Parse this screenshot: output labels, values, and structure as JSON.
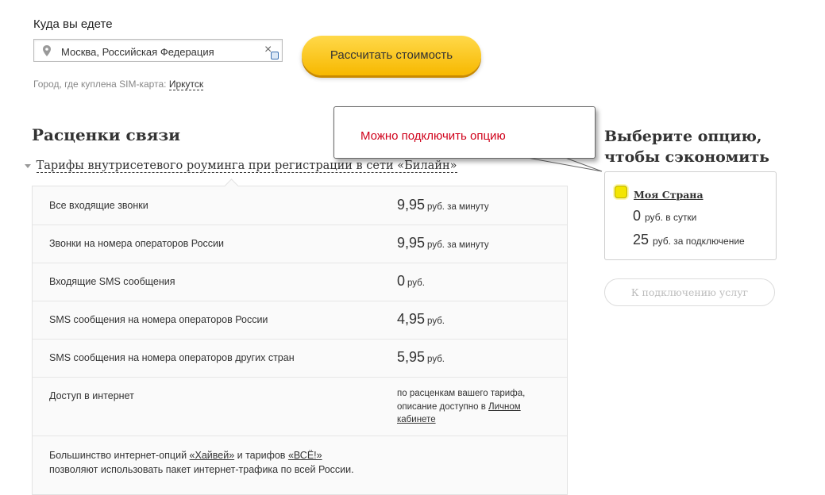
{
  "destination": {
    "label": "Куда вы едете",
    "value": "Москва, Российская Федерация",
    "calc_button": "Рассчитать стоимость"
  },
  "sim": {
    "label": "Город, где куплена SIM-карта:",
    "city": "Иркутск"
  },
  "rates": {
    "title": "Расценки связи",
    "tariffs_link": "Тарифы внутрисетевого роуминга при регистрации в сети «Билайн»",
    "rows": [
      {
        "name": "Все входящие звонки",
        "value": "9,95",
        "unit": "руб. за минуту"
      },
      {
        "name": "Звонки на номера операторов России",
        "value": "9,95",
        "unit": "руб. за минуту"
      },
      {
        "name": "Входящие SMS сообщения",
        "value": "0",
        "unit": "руб."
      },
      {
        "name": "SMS сообщения на номера операторов России",
        "value": "4,95",
        "unit": "руб."
      },
      {
        "name": "SMS сообщения на номера операторов других стран",
        "value": "5,95",
        "unit": "руб."
      }
    ],
    "internet": {
      "name": "Доступ в интернет",
      "note_line1": "по расценкам вашего тарифа,",
      "note_line2": "описание доступно в",
      "note_link1": "Личном",
      "note_link2": "кабинете"
    },
    "footer": {
      "text1": "Большинство интернет-опций",
      "link1": "«Хайвей»",
      "text2": "и тарифов",
      "link2": "«ВСЁ!»",
      "text3": "позволяют использовать пакет интернет-трафика по всей России."
    }
  },
  "tooltip": {
    "text": "Можно подключить опцию"
  },
  "options": {
    "title_line1": "Выберите опцию,",
    "title_line2": "чтобы сэкономить",
    "option": {
      "name": "Моя Страна",
      "line1_value": "0",
      "line1_unit": "руб. в сутки",
      "line2_value": "25",
      "line2_unit": "руб. за подключение"
    },
    "connect_button": "К подключению услуг"
  },
  "colors": {
    "accent_yellow": "#f7b800",
    "tooltip_text": "#d0021b",
    "checkbox_yellow": "#f3e500"
  }
}
